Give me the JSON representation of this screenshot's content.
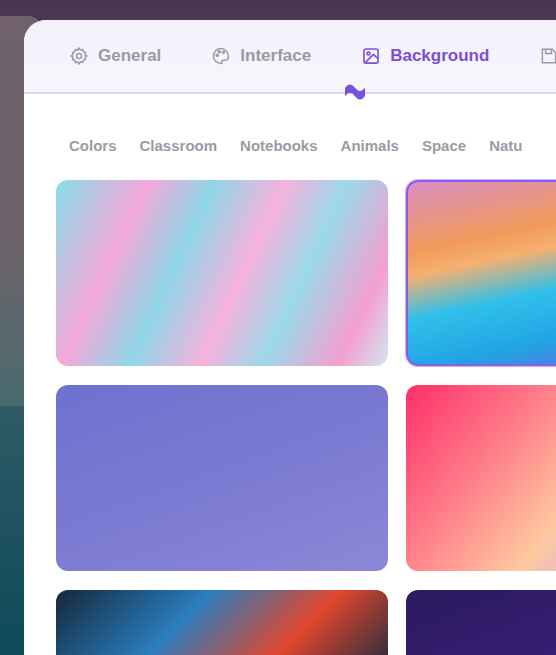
{
  "tabs": [
    {
      "label": "General",
      "selected": false,
      "icon": "gear"
    },
    {
      "label": "Interface",
      "selected": false,
      "icon": "palette"
    },
    {
      "label": "Background",
      "selected": true,
      "icon": "image"
    }
  ],
  "categories": [
    "Colors",
    "Classroom",
    "Notebooks",
    "Animals",
    "Space",
    "Natu"
  ],
  "backgrounds": [
    {
      "selected": false
    },
    {
      "selected": true
    },
    {
      "selected": false
    },
    {
      "selected": false
    },
    {
      "selected": false
    },
    {
      "selected": false
    }
  ]
}
